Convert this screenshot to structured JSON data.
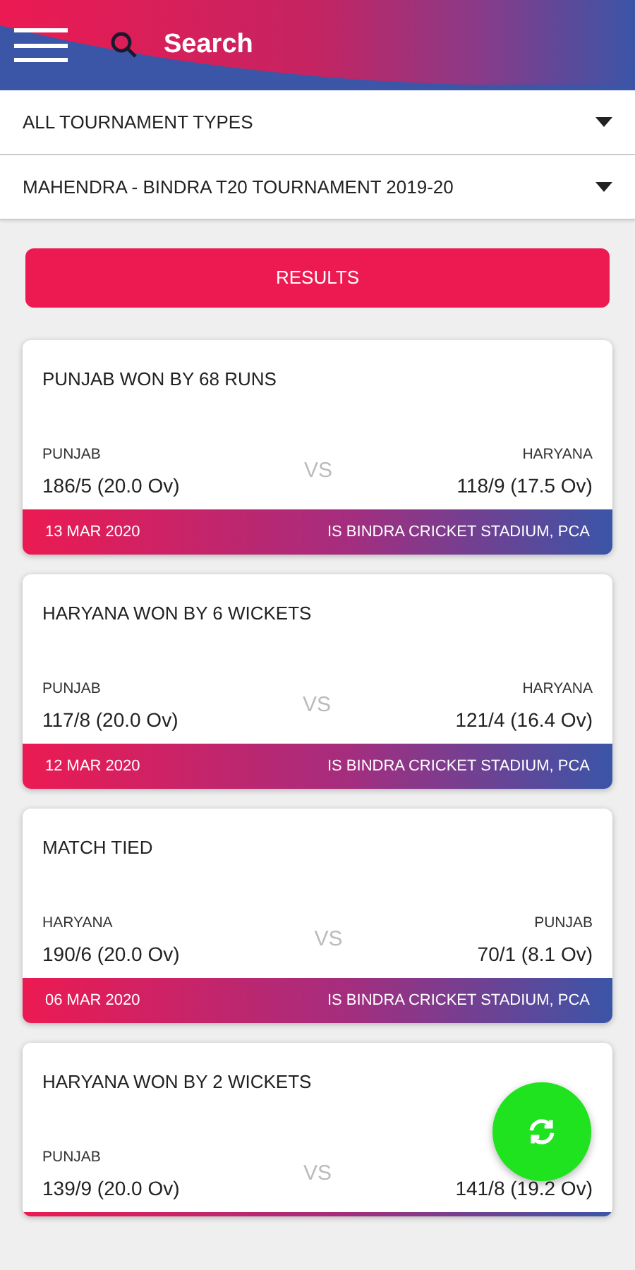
{
  "header": {
    "search_label": "Search"
  },
  "filters": [
    {
      "value": "ALL TOURNAMENT TYPES"
    },
    {
      "value": "MAHENDRA - BINDRA T20 TOURNAMENT 2019-20"
    }
  ],
  "results_button": "RESULTS",
  "matches": [
    {
      "result": "PUNJAB WON BY 68 RUNS",
      "home_team": "PUNJAB",
      "home_score": "186/5 (20.0 Ov)",
      "vs": "VS",
      "away_team": "HARYANA",
      "away_score": "118/9 (17.5 Ov)",
      "date": "13 MAR 2020",
      "venue": "IS BINDRA CRICKET STADIUM, PCA"
    },
    {
      "result": "HARYANA WON BY 6 WICKETS",
      "home_team": "PUNJAB",
      "home_score": "117/8 (20.0 Ov)",
      "vs": "VS",
      "away_team": "HARYANA",
      "away_score": "121/4 (16.4 Ov)",
      "date": "12 MAR 2020",
      "venue": "IS BINDRA CRICKET STADIUM, PCA"
    },
    {
      "result": "MATCH TIED",
      "home_team": "HARYANA",
      "home_score": "190/6 (20.0 Ov)",
      "vs": "VS",
      "away_team": "PUNJAB",
      "away_score": "70/1 (8.1 Ov)",
      "date": "06 MAR 2020",
      "venue": "IS BINDRA CRICKET STADIUM, PCA"
    },
    {
      "result": "HARYANA WON BY 2 WICKETS",
      "home_team": "PUNJAB",
      "home_score": "139/9 (20.0 Ov)",
      "vs": "VS",
      "away_score": "141/8 (19.2 Ov)"
    }
  ]
}
